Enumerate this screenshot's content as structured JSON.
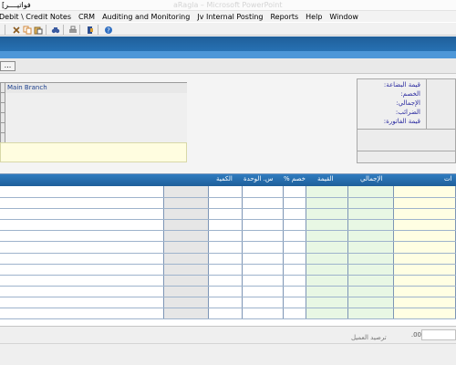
{
  "window": {
    "title": "[فواتيــــر",
    "faint_title": "aRagla – Microsoft PowerPoint"
  },
  "menu": {
    "items": [
      "Debit \\ Credit Notes",
      "CRM",
      "Auditing and Monitoring",
      "Jv Internal Posting",
      "Reports",
      "Help",
      "Window"
    ]
  },
  "toolbar": {
    "icons": [
      "close-icon",
      "copy-icon",
      "paste-icon",
      "find-icon",
      "print-icon",
      "exit-icon",
      "help-icon"
    ]
  },
  "strip": {
    "more_label": "..."
  },
  "branch": {
    "rows": [
      "Main Branch",
      "",
      "",
      "",
      "",
      ""
    ]
  },
  "info_panel": {
    "labels": [
      ":قيمة البضاعة",
      ":الخصم",
      ":الإجمالي",
      ":الضرائب",
      ":قيمة الفاتورة"
    ]
  },
  "lines_grid": {
    "headers": {
      "qty": "الكمية",
      "unit_price": "س. الوحدة",
      "discount_pct": "% خصم",
      "value": "القيمة",
      "total": "الإجمالي",
      "item": "ات"
    },
    "row_count": 12
  },
  "footer": {
    "balance_label": "ترصيد العميل",
    "balance_value": ".00"
  },
  "colors": {
    "header_blue": "#2b6fae",
    "note_yellow": "#fffde0",
    "col_green": "#e8f7e4",
    "col_yellow": "#fffee3",
    "col_gray": "#e6e6e6"
  }
}
